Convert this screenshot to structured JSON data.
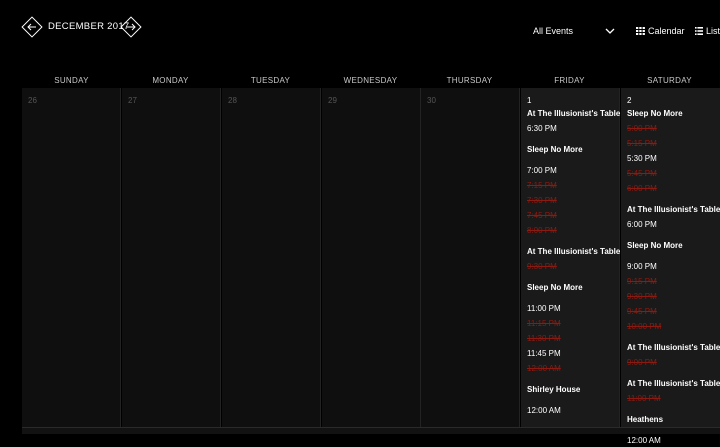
{
  "header": {
    "month": "DECEMBER 2017",
    "filter_selected": "All Events",
    "view_calendar": "Calendar",
    "view_list": "List"
  },
  "weekdays": [
    "SUNDAY",
    "MONDAY",
    "TUESDAY",
    "WEDNESDAY",
    "THURSDAY",
    "FRIDAY",
    "SATURDAY"
  ],
  "days": [
    {
      "num": "26"
    },
    {
      "num": "27"
    },
    {
      "num": "28"
    },
    {
      "num": "29"
    },
    {
      "num": "30"
    },
    {
      "num": "1",
      "events": [
        {
          "kind": "title",
          "text": "At The Illusionist's Table"
        },
        {
          "kind": "time",
          "text": "6:30 PM",
          "tight": true
        },
        {
          "kind": "title",
          "text": "Sleep No More"
        },
        {
          "kind": "time",
          "text": "7:00 PM"
        },
        {
          "kind": "sold",
          "text": "7:15 PM"
        },
        {
          "kind": "sold",
          "text": "7:30 PM"
        },
        {
          "kind": "sold",
          "text": "7:45 PM"
        },
        {
          "kind": "sold",
          "text": "8:00 PM"
        },
        {
          "kind": "title",
          "text": "At The Illusionist's Table"
        },
        {
          "kind": "sold",
          "text": "9:30 PM"
        },
        {
          "kind": "title",
          "text": "Sleep No More"
        },
        {
          "kind": "time",
          "text": "11:00 PM"
        },
        {
          "kind": "sold",
          "text": "11:15 PM"
        },
        {
          "kind": "sold",
          "text": "11:30 PM"
        },
        {
          "kind": "time",
          "text": "11:45 PM",
          "tight": true
        },
        {
          "kind": "sold",
          "text": "12:00 AM"
        },
        {
          "kind": "title",
          "text": "Shirley House"
        },
        {
          "kind": "time",
          "text": "12:00 AM"
        }
      ]
    },
    {
      "num": "2",
      "events": [
        {
          "kind": "title",
          "text": "Sleep No More"
        },
        {
          "kind": "sold",
          "text": "5:00 PM"
        },
        {
          "kind": "sold",
          "text": "5:15 PM"
        },
        {
          "kind": "time",
          "text": "5:30 PM",
          "tight": true
        },
        {
          "kind": "sold",
          "text": "5:45 PM"
        },
        {
          "kind": "sold",
          "text": "6:00 PM"
        },
        {
          "kind": "title",
          "text": "At The Illusionist's Table"
        },
        {
          "kind": "time",
          "text": "6:00 PM",
          "tight": true
        },
        {
          "kind": "title",
          "text": "Sleep No More"
        },
        {
          "kind": "time",
          "text": "9:00 PM"
        },
        {
          "kind": "sold",
          "text": "9:15 PM"
        },
        {
          "kind": "sold",
          "text": "9:30 PM"
        },
        {
          "kind": "sold",
          "text": "9:45 PM"
        },
        {
          "kind": "sold",
          "text": "10:00 PM"
        },
        {
          "kind": "title",
          "text": "At The Illusionist's Table"
        },
        {
          "kind": "sold",
          "text": "9:00 PM"
        },
        {
          "kind": "title",
          "text": "At The Illusionist's Table"
        },
        {
          "kind": "sold",
          "text": "11:00 PM"
        },
        {
          "kind": "title",
          "text": "Heathens"
        },
        {
          "kind": "time",
          "text": "12:00 AM"
        }
      ]
    }
  ],
  "colors": {
    "sold_out": "#8a1b12",
    "active_day_bg": "#1a1a1a",
    "day_bg": "#0f0f0f"
  }
}
